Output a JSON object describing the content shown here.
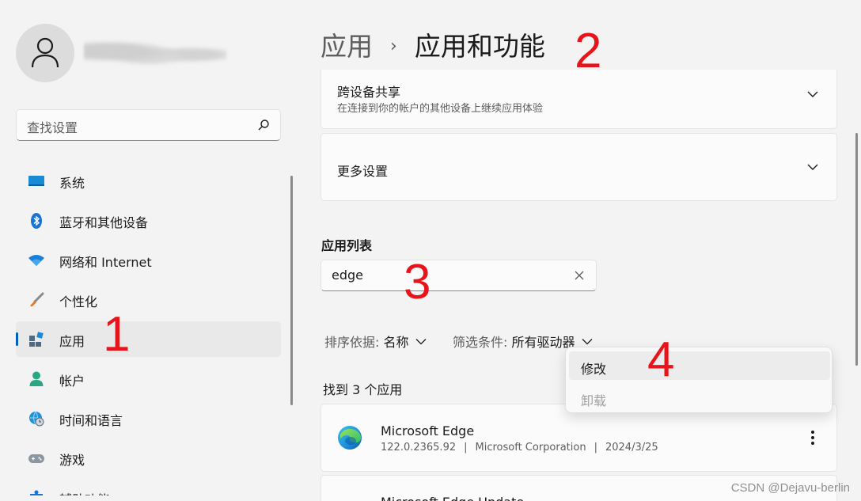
{
  "sidebar": {
    "search_placeholder": "查找设置",
    "items": [
      {
        "label": "系统",
        "icon": "monitor-icon"
      },
      {
        "label": "蓝牙和其他设备",
        "icon": "bluetooth-icon"
      },
      {
        "label": "网络和 Internet",
        "icon": "wifi-icon"
      },
      {
        "label": "个性化",
        "icon": "brush-icon"
      },
      {
        "label": "应用",
        "icon": "apps-icon",
        "active": true
      },
      {
        "label": "帐户",
        "icon": "person-icon"
      },
      {
        "label": "时间和语言",
        "icon": "globe-clock-icon"
      },
      {
        "label": "游戏",
        "icon": "gamepad-icon"
      },
      {
        "label": "辅助功能",
        "icon": "accessibility-icon"
      }
    ]
  },
  "header": {
    "breadcrumb_parent": "应用",
    "breadcrumb_separator": "›",
    "breadcrumb_current": "应用和功能"
  },
  "cards": {
    "cross_device": {
      "title": "跨设备共享",
      "description": "在连接到你的帐户的其他设备上继续应用体验"
    },
    "more_settings": {
      "title": "更多设置"
    }
  },
  "app_list": {
    "title": "应用列表",
    "search_value": "edge",
    "sort_key": "排序依据:",
    "sort_value": "名称",
    "filter_key": "筛选条件:",
    "filter_value": "所有驱动器",
    "found_text": "找到 3 个应用",
    "apps": [
      {
        "name": "Microsoft Edge",
        "version": "122.0.2365.92",
        "publisher": "Microsoft Corporation",
        "date": "2024/3/25"
      },
      {
        "name": "Microsoft Edge Update"
      }
    ]
  },
  "context_menu": {
    "items": [
      {
        "label": "修改",
        "enabled": true
      },
      {
        "label": "卸载",
        "enabled": false
      }
    ]
  },
  "annotations": [
    "1",
    "2",
    "3",
    "4"
  ],
  "watermark": "CSDN @Dejavu-berlin",
  "colors": {
    "accent": "#005fb8",
    "annotation": "#e8141b",
    "background": "#f3f3f3"
  }
}
